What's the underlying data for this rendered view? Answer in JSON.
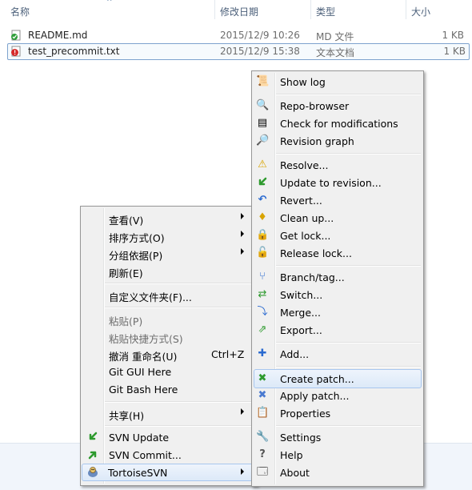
{
  "columns": {
    "name": "名称",
    "date": "修改日期",
    "type": "类型",
    "size": "大小"
  },
  "files": [
    {
      "name": "README.md",
      "date": "2015/12/9 10:26",
      "type": "MD 文件",
      "size": "1 KB",
      "icon": "svn-normal-file-icon"
    },
    {
      "name": "test_precommit.txt",
      "date": "2015/12/9 15:38",
      "type": "文本文档",
      "size": "1 KB",
      "icon": "svn-modified-file-icon"
    }
  ],
  "explorer_menu": {
    "view": "查看(V)",
    "sort_by": "排序方式(O)",
    "group_by": "分组依据(P)",
    "refresh": "刷新(E)",
    "customize": "自定义文件夹(F)...",
    "paste": "粘贴(P)",
    "paste_shortcut": "粘贴快捷方式(S)",
    "undo": "撤消 重命名(U)",
    "undo_shortcut": "Ctrl+Z",
    "git_gui": "Git GUI Here",
    "git_bash": "Git Bash Here",
    "share": "共享(H)",
    "svn_update": "SVN Update",
    "svn_commit": "SVN Commit...",
    "tortoise": "TortoiseSVN"
  },
  "svn_menu": {
    "show_log": "Show log",
    "repo_browser": "Repo-browser",
    "check_mods": "Check for modifications",
    "revision_graph": "Revision graph",
    "resolve": "Resolve...",
    "update_rev": "Update to revision...",
    "revert": "Revert...",
    "clean_up": "Clean up...",
    "get_lock": "Get lock...",
    "release_lock": "Release lock...",
    "branch_tag": "Branch/tag...",
    "switch": "Switch...",
    "merge": "Merge...",
    "export": "Export...",
    "add": "Add...",
    "create_patch": "Create patch...",
    "apply_patch": "Apply patch...",
    "properties": "Properties",
    "settings": "Settings",
    "help": "Help",
    "about": "About"
  },
  "colors": {
    "hover_border": "#a8c6ee",
    "menu_bg": "#f0f0f0",
    "header_text": "#4c607a"
  }
}
